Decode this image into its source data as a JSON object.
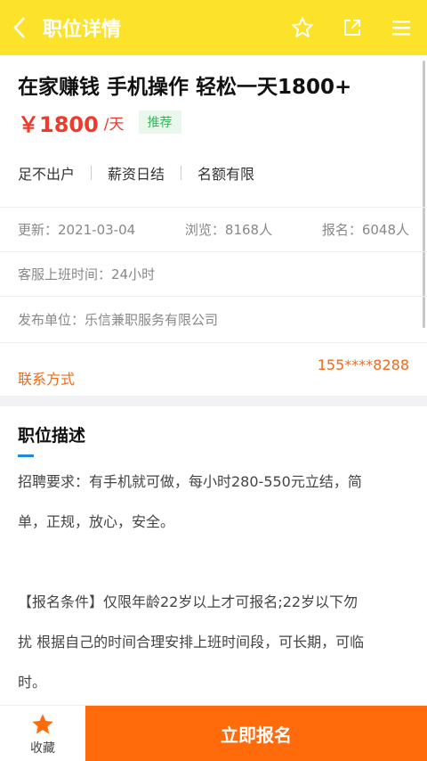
{
  "header": {
    "title": "职位详情",
    "icons": [
      "back-arrow-icon",
      "star-outline-icon",
      "share-icon",
      "menu-icon"
    ]
  },
  "job": {
    "title": "在家赚钱 手机操作 轻松一天1800+",
    "salary": "￥1800",
    "unit": "/天",
    "badge": "推荐",
    "tags": [
      "足不出户",
      "薪资日结",
      "名额有限"
    ]
  },
  "stats": {
    "updated": "更新：2021-03-04",
    "views": "浏览：8168人",
    "applied": "报名：6048人"
  },
  "service_hours": "客服上班时间：24小时",
  "publisher": "发布单位：乐信兼职服务有限公司",
  "contact": {
    "label": "联系方式",
    "phone": "155****8288"
  },
  "description": {
    "title": "职位描述",
    "line1": "招聘要求：有手机就可做，每小时280-550元立结，简",
    "line2": "单，正规，放心，安全。",
    "line3": "【报名条件】仅限年龄22岁以上才可报名;22岁以下勿",
    "line4": "扰 根据自己的时间合理安排上班时间段，可长期，可临",
    "line5": "时。"
  },
  "bottom": {
    "fav_label": "收藏",
    "apply_label": "立即报名"
  },
  "colors": {
    "header_bg": "#fde22b",
    "salary": "#f03a2b",
    "contact": "#f06a1a",
    "apply_bg": "#ff6b0b",
    "accent_blue": "#1e88e5"
  }
}
